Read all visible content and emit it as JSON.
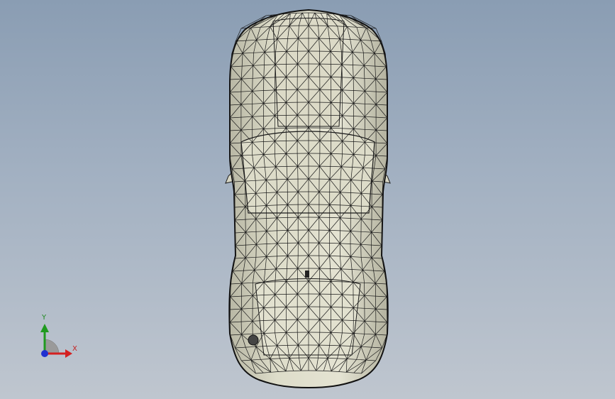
{
  "viewport": {
    "background_top": "#8a9db3",
    "background_bottom": "#bfc6cf"
  },
  "model": {
    "name_icon": "car-wireframe-top-view",
    "fill_color": "#d9d8c6",
    "shade_color": "#b9b8a6",
    "edge_color": "#1a1a1a"
  },
  "triad": {
    "x_label": "X",
    "y_label": "Y",
    "x_color": "#d42020",
    "y_color": "#1f9a1f",
    "z_color": "#2030d0"
  }
}
